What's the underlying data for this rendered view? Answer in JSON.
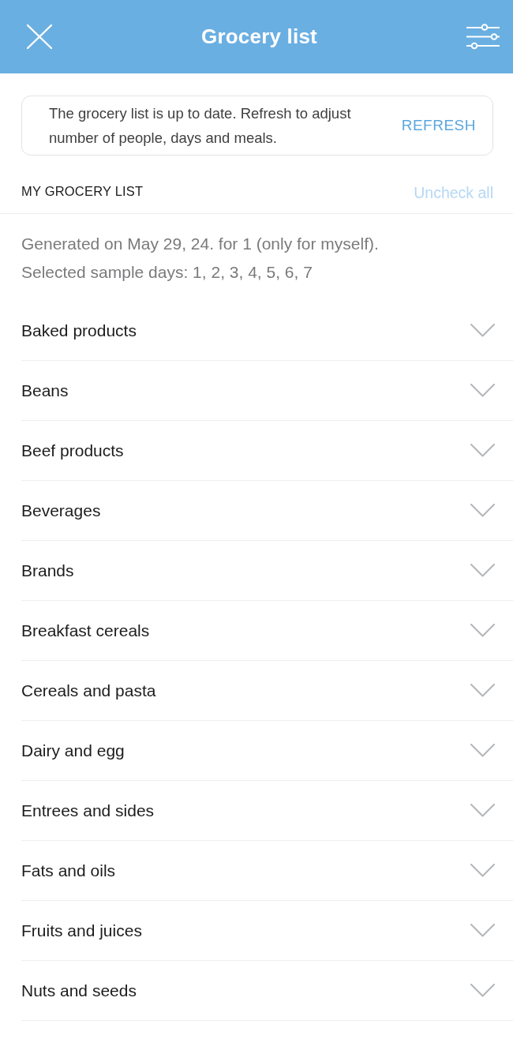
{
  "header": {
    "title": "Grocery list"
  },
  "notice": {
    "text": "The grocery list is up to date. Refresh to adjust number of people, days and meals.",
    "action": "REFRESH"
  },
  "section": {
    "title": "MY GROCERY LIST",
    "uncheck_all": {
      "label": "Uncheck all",
      "disabled": true
    }
  },
  "info": [
    "Generated on May 29, 24. for 1 (only for myself).",
    "Selected sample days: 1, 2, 3, 4, 5, 6, 7"
  ],
  "categories": [
    {
      "label": "Baked products",
      "expanded": false
    },
    {
      "label": "Beans",
      "expanded": false
    },
    {
      "label": "Beef products",
      "expanded": false
    },
    {
      "label": "Beverages",
      "expanded": false
    },
    {
      "label": "Brands",
      "expanded": false
    },
    {
      "label": "Breakfast cereals",
      "expanded": false
    },
    {
      "label": "Cereals and pasta",
      "expanded": false
    },
    {
      "label": "Dairy and egg",
      "expanded": false
    },
    {
      "label": "Entrees and sides",
      "expanded": false
    },
    {
      "label": "Fats and oils",
      "expanded": false
    },
    {
      "label": "Fruits and juices",
      "expanded": false
    },
    {
      "label": "Nuts and seeds",
      "expanded": false
    }
  ]
}
